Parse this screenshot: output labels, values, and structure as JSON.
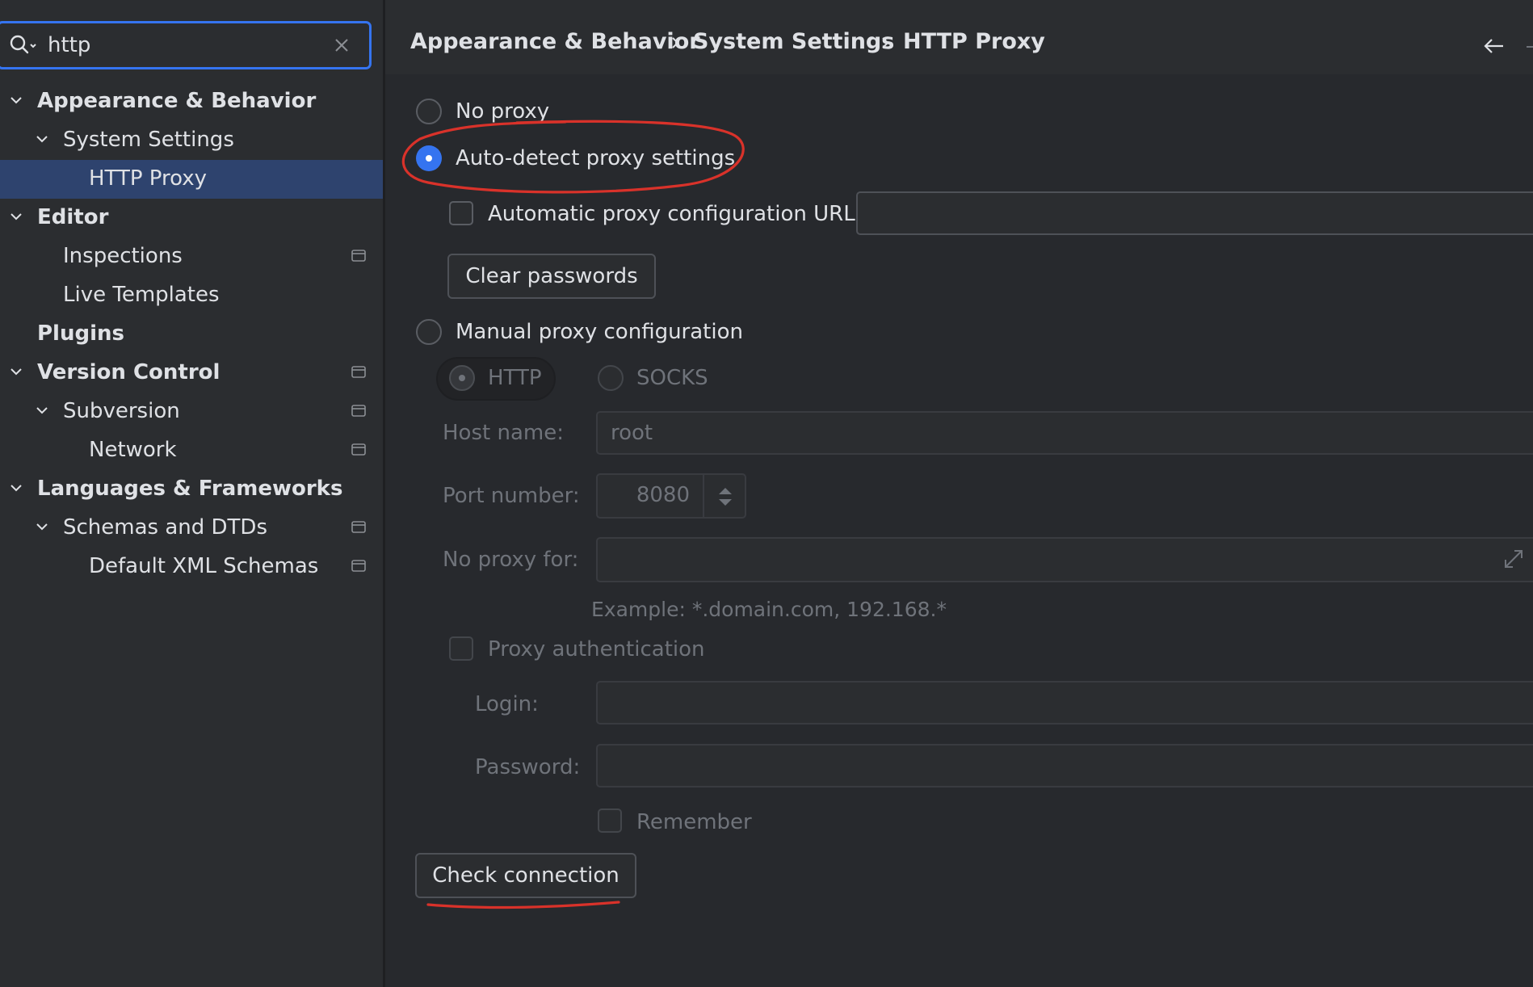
{
  "search": {
    "value": "http",
    "placeholder": ""
  },
  "tree": [
    {
      "label": "Appearance & Behavior",
      "bold": true,
      "level": 0,
      "expanded": true,
      "project": false,
      "selected": false
    },
    {
      "label": "System Settings",
      "bold": false,
      "level": 1,
      "expanded": true,
      "project": false,
      "selected": false
    },
    {
      "label": "HTTP Proxy",
      "bold": false,
      "level": 2,
      "expanded": null,
      "project": false,
      "selected": true
    },
    {
      "label": "Editor",
      "bold": true,
      "level": 0,
      "expanded": true,
      "project": false,
      "selected": false
    },
    {
      "label": "Inspections",
      "bold": false,
      "level": 1,
      "expanded": null,
      "project": true,
      "selected": false
    },
    {
      "label": "Live Templates",
      "bold": false,
      "level": 1,
      "expanded": null,
      "project": false,
      "selected": false
    },
    {
      "label": "Plugins",
      "bold": true,
      "level": 0,
      "expanded": null,
      "project": false,
      "selected": false
    },
    {
      "label": "Version Control",
      "bold": true,
      "level": 0,
      "expanded": true,
      "project": true,
      "selected": false
    },
    {
      "label": "Subversion",
      "bold": false,
      "level": 1,
      "expanded": true,
      "project": true,
      "selected": false
    },
    {
      "label": "Network",
      "bold": false,
      "level": 2,
      "expanded": null,
      "project": true,
      "selected": false
    },
    {
      "label": "Languages & Frameworks",
      "bold": true,
      "level": 0,
      "expanded": true,
      "project": false,
      "selected": false
    },
    {
      "label": "Schemas and DTDs",
      "bold": false,
      "level": 1,
      "expanded": true,
      "project": true,
      "selected": false
    },
    {
      "label": "Default XML Schemas",
      "bold": false,
      "level": 2,
      "expanded": null,
      "project": true,
      "selected": false
    }
  ],
  "breadcrumb": [
    "Appearance & Behavior",
    "System Settings",
    "HTTP Proxy"
  ],
  "proxy": {
    "no_proxy": "No proxy",
    "auto_detect": "Auto-detect proxy settings",
    "auto_config_url": "Automatic proxy configuration URL:",
    "clear_passwords": "Clear passwords",
    "manual": "Manual proxy configuration",
    "http": "HTTP",
    "socks": "SOCKS",
    "host_label": "Host name:",
    "host_value": "root",
    "port_label": "Port number:",
    "port_value": "8080",
    "no_proxy_for_label": "No proxy for:",
    "example": "Example: *.domain.com, 192.168.*",
    "proxy_auth": "Proxy authentication",
    "login_label": "Login:",
    "password_label": "Password:",
    "remember": "Remember",
    "check_connection": "Check connection"
  },
  "colors": {
    "accent": "#3574f0",
    "selection": "#2e436e",
    "annotation": "#d9322a"
  }
}
